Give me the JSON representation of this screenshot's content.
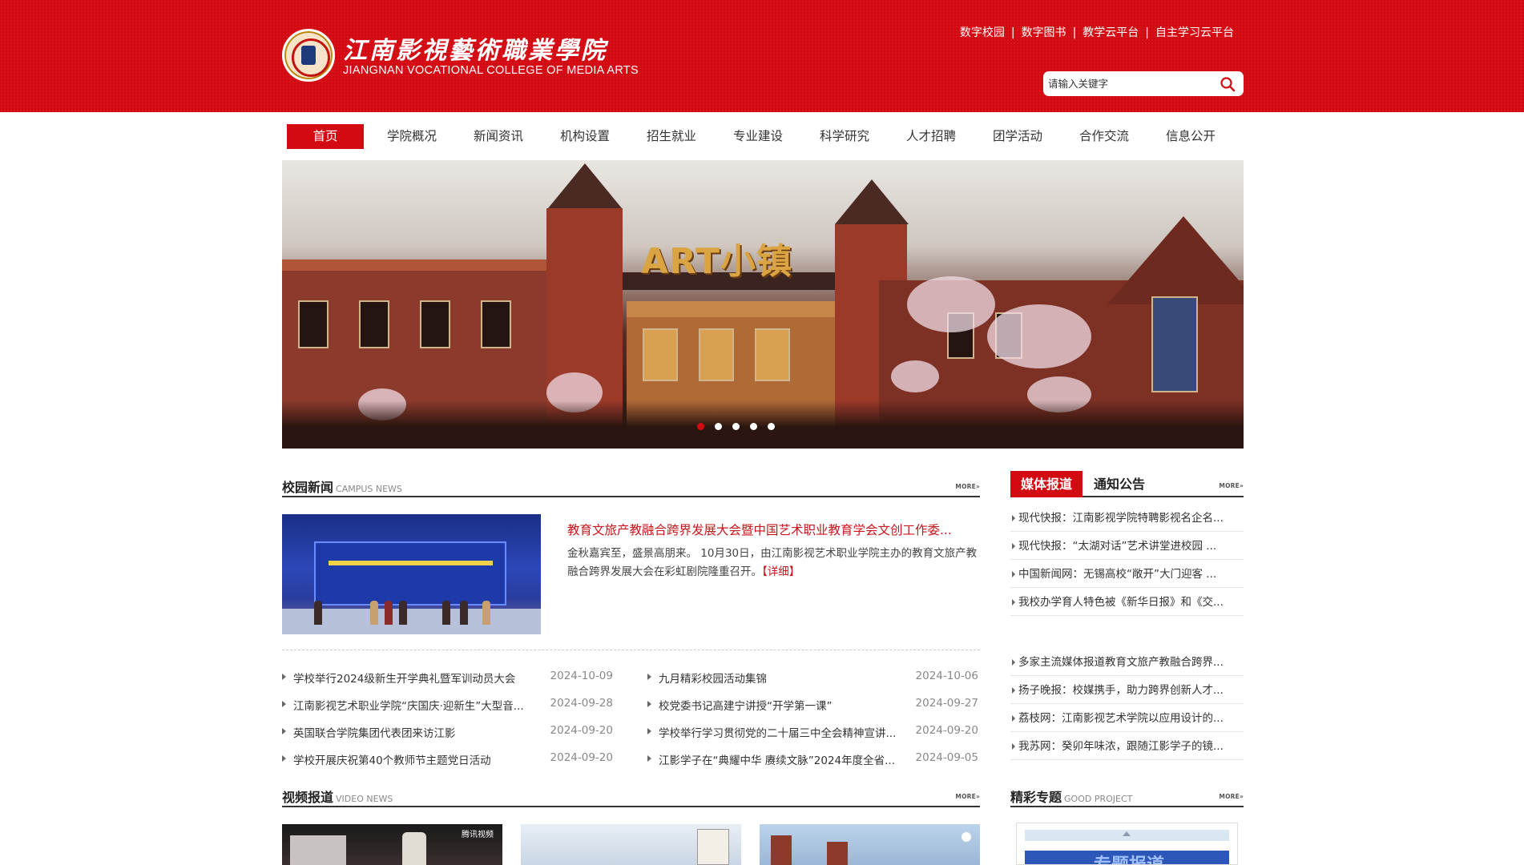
{
  "header": {
    "logo_cn": "江南影視藝術職業學院",
    "logo_en": "JIANGNAN VOCATIONAL COLLEGE OF MEDIA ARTS",
    "top_links": [
      "数字校园",
      "数字图书",
      "教学云平台",
      "自主学习云平台"
    ],
    "search_placeholder": "请输入关键字",
    "brand_color": "#d40a12"
  },
  "nav": {
    "items": [
      "首页",
      "学院概况",
      "新闻资讯",
      "机构设置",
      "招生就业",
      "专业建设",
      "科学研究",
      "人才招聘",
      "团学活动",
      "合作交流",
      "信息公开"
    ],
    "active_index": 0
  },
  "banner": {
    "sign_text": "ART小镇",
    "slide_count": 5,
    "active_slide": 0
  },
  "campus_news": {
    "title": "校园新闻",
    "title_en": "CAMPUS NEWS",
    "more": "MORE»",
    "featured": {
      "headline": "教育文旅产教融合跨界发展大会暨中国艺术职业教育学会文创工作委...",
      "summary": "金秋嘉宾至，盛景高朋来。 10月30日，由江南影视艺术职业学院主办的教育文旅产教融合跨界发展大会在彩虹剧院隆重召开。",
      "detail": "【详细】"
    },
    "left": [
      {
        "title": "学校举行2024级新生开学典礼暨军训动员大会",
        "date": "2024-10-09"
      },
      {
        "title": "江南影视艺术职业学院“庆国庆·迎新生”大型音...",
        "date": "2024-09-28"
      },
      {
        "title": "英国联合学院集团代表团来访江影",
        "date": "2024-09-20"
      },
      {
        "title": "学校开展庆祝第40个教师节主题党日活动",
        "date": "2024-09-20"
      }
    ],
    "right": [
      {
        "title": "九月精彩校园活动集锦",
        "date": "2024-10-06"
      },
      {
        "title": "校党委书记高建宁讲授“开学第一课”",
        "date": "2024-09-27"
      },
      {
        "title": "学校举行学习贯彻党的二十届三中全会精神宣讲...",
        "date": "2024-09-20"
      },
      {
        "title": "江影学子在“典耀中华 赓续文脉”2024年度全省...",
        "date": "2024-09-05"
      }
    ]
  },
  "media": {
    "tab_active": "媒体报道",
    "tab_other": "通知公告",
    "more": "MORE»",
    "group1": [
      "现代快报：江南影视学院特聘影视名企名...",
      "现代快报：“太湖对话”艺术讲堂进校园 ...",
      "中国新闻网：无锡高校“敞开”大门迎客 ...",
      "我校办学育人特色被《新华日报》和《交..."
    ],
    "group2": [
      "多家主流媒体报道教育文旅产教融合跨界...",
      "扬子晚报：校媒携手，助力跨界创新人才...",
      "荔枝网：江南影视艺术学院以应用设计的...",
      "我苏网：癸卯年味浓，跟随江影学子的镜..."
    ]
  },
  "video": {
    "title": "视频报道",
    "title_en": "VIDEO NEWS",
    "more": "MORE»",
    "thumb_badge": "腾讯视频"
  },
  "project": {
    "title": "精彩专题",
    "title_en": "GOOD PROJECT",
    "more": "MORE»",
    "thumb_text": "专题报道"
  }
}
